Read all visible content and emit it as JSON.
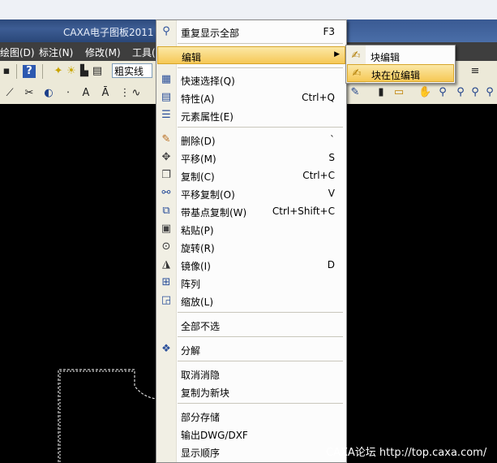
{
  "window": {
    "title": "CAXA电子图板2011"
  },
  "menubar": {
    "items": [
      "绘图(D)",
      "标注(N)",
      "修改(M)",
      "工具("
    ]
  },
  "toolbar": {
    "linetype_label": "粗实线"
  },
  "context_menu": {
    "items": [
      {
        "label": "重复显示全部",
        "shortcut": "F3",
        "icon": "zoom-icon"
      },
      {
        "label": "编辑",
        "shortcut": "",
        "icon": "",
        "submenu": true,
        "highlighted": true
      },
      {
        "label": "快速选择(Q)",
        "shortcut": "",
        "icon": "quick-select-icon"
      },
      {
        "label": "特性(A)",
        "shortcut": "Ctrl+Q",
        "icon": "properties-icon"
      },
      {
        "label": "元素属性(E)",
        "shortcut": "",
        "icon": "element-attr-icon"
      },
      {
        "label": "删除(D)",
        "shortcut": "`",
        "icon": "delete-icon"
      },
      {
        "label": "平移(M)",
        "shortcut": "S",
        "icon": "move-icon"
      },
      {
        "label": "复制(C)",
        "shortcut": "Ctrl+C",
        "icon": "copy-icon"
      },
      {
        "label": "平移复制(O)",
        "shortcut": "V",
        "icon": "move-copy-icon"
      },
      {
        "label": "带基点复制(W)",
        "shortcut": "Ctrl+Shift+C",
        "icon": "base-copy-icon"
      },
      {
        "label": "粘贴(P)",
        "shortcut": "",
        "icon": "paste-icon"
      },
      {
        "label": "旋转(R)",
        "shortcut": "",
        "icon": "rotate-icon"
      },
      {
        "label": "镜像(I)",
        "shortcut": "D",
        "icon": "mirror-icon"
      },
      {
        "label": "阵列",
        "shortcut": "",
        "icon": "array-icon"
      },
      {
        "label": "缩放(L)",
        "shortcut": "",
        "icon": "scale-icon"
      },
      {
        "label": "全部不选",
        "shortcut": "",
        "icon": ""
      },
      {
        "label": "分解",
        "shortcut": "",
        "icon": "explode-icon"
      },
      {
        "label": "取消消隐",
        "shortcut": "",
        "icon": ""
      },
      {
        "label": "复制为新块",
        "shortcut": "",
        "icon": ""
      },
      {
        "label": "部分存储",
        "shortcut": "",
        "icon": ""
      },
      {
        "label": "输出DWG/DXF",
        "shortcut": "",
        "icon": ""
      },
      {
        "label": "显示顺序",
        "shortcut": "",
        "icon": ""
      }
    ]
  },
  "submenu": {
    "items": [
      {
        "label": "块编辑",
        "icon": "block-edit-icon"
      },
      {
        "label": "块在位编辑",
        "icon": "block-inplace-edit-icon",
        "highlighted": true
      }
    ]
  },
  "watermark": {
    "text": "CAXA论坛 http://top.caxa.com/"
  },
  "colors": {
    "highlight": "#f6c856",
    "canvas": "#000000",
    "menubar": "#3e3e3e"
  }
}
